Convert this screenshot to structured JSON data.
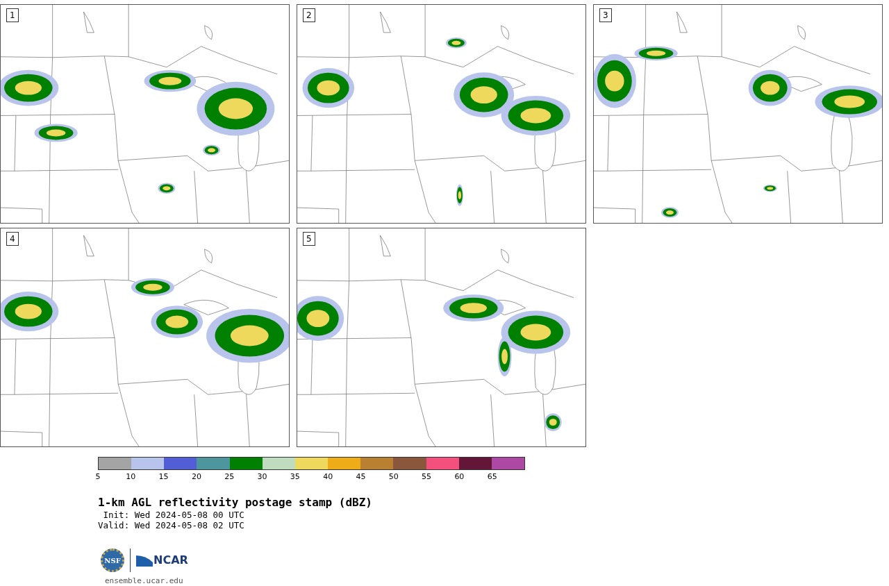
{
  "panels": [
    {
      "label": "1"
    },
    {
      "label": "2"
    },
    {
      "label": "3"
    },
    {
      "label": "4"
    },
    {
      "label": "5"
    }
  ],
  "colorbar": {
    "segments": [
      {
        "color": "#a4a4a4"
      },
      {
        "color": "#b8c4ec"
      },
      {
        "color": "#515ed6"
      },
      {
        "color": "#4e969d"
      },
      {
        "color": "#008000"
      },
      {
        "color": "#bfdcbf"
      },
      {
        "color": "#eed95c"
      },
      {
        "color": "#eeac18"
      },
      {
        "color": "#b98032"
      },
      {
        "color": "#8a573d"
      },
      {
        "color": "#f4507e"
      },
      {
        "color": "#631637"
      },
      {
        "color": "#ad49a5"
      }
    ],
    "ticks": [
      "5",
      "10",
      "15",
      "20",
      "25",
      "30",
      "35",
      "40",
      "45",
      "50",
      "55",
      "60",
      "65"
    ]
  },
  "title": "1-km AGL reflectivity postage stamp (dBZ)",
  "init": " Init: Wed 2024-05-08 00 UTC",
  "valid": "Valid: Wed 2024-05-08 02 UTC",
  "logos": {
    "nsf": "NSF",
    "ncar": "NCAR"
  },
  "site": "ensemble.ucar.edu"
}
